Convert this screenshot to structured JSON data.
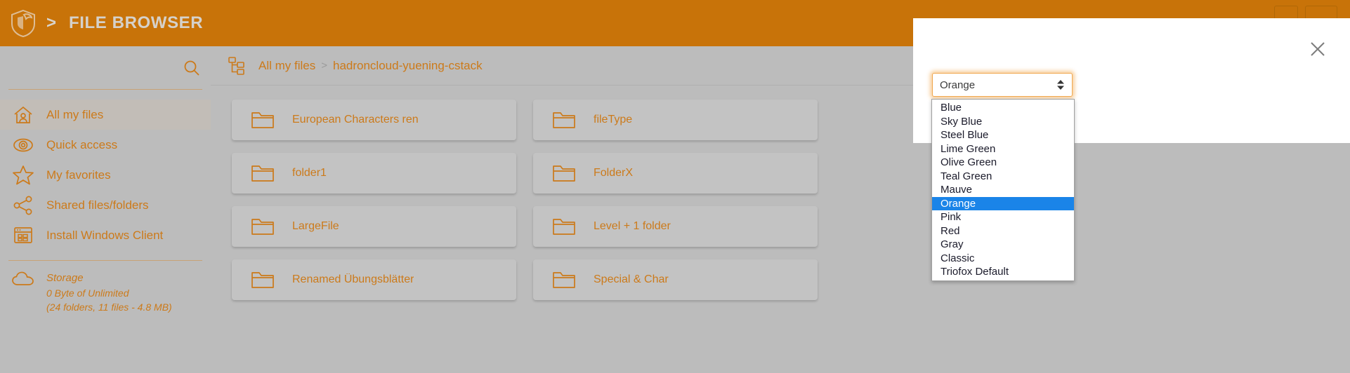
{
  "topbar": {
    "logo_icon": "shield-logo-icon",
    "separator": ">",
    "title": "FILE BROWSER",
    "accent_color": "#c87309"
  },
  "sidebar": {
    "search": {
      "value": "",
      "placeholder": "",
      "icon": "search-icon"
    },
    "items": [
      {
        "label": "All my files",
        "icon": "home-user-icon",
        "active": true
      },
      {
        "label": "Quick access",
        "icon": "eye-target-icon",
        "active": false
      },
      {
        "label": "My favorites",
        "icon": "star-icon",
        "active": false
      },
      {
        "label": "Shared files/folders",
        "icon": "share-nodes-icon",
        "active": false
      },
      {
        "label": "Install Windows Client",
        "icon": "app-window-icon",
        "active": false
      }
    ],
    "storage": {
      "icon": "cloud-icon",
      "title": "Storage",
      "used_line": "0 Byte of Unlimited",
      "detail_line": "(24 folders, 11 files - 4.8 MB)"
    }
  },
  "breadcrumb": {
    "icon": "folder-tree-icon",
    "root": "All my files",
    "separator": ">",
    "current": "hadroncloud-yuening-cstack"
  },
  "files": {
    "icon": "folder-icon",
    "items": [
      {
        "name": "European Characters ren"
      },
      {
        "name": "fileType"
      },
      {
        "name": "folder1"
      },
      {
        "name": "FolderX"
      },
      {
        "name": "LargeFile"
      },
      {
        "name": "Level + 1 folder"
      },
      {
        "name": "Renamed Übungsblätter"
      },
      {
        "name": "Special & Char"
      }
    ]
  },
  "dialog": {
    "close_icon": "close-icon",
    "theme_select": {
      "value": "Orange",
      "arrows_icon": "updown-arrows-icon",
      "options": [
        "Blue",
        "Sky Blue",
        "Steel Blue",
        "Lime Green",
        "Olive Green",
        "Teal Green",
        "Mauve",
        "Orange",
        "Pink",
        "Red",
        "Gray",
        "Classic",
        "Triofox Default"
      ],
      "selected_index": 7,
      "highlight_color": "#1a84e8"
    }
  }
}
